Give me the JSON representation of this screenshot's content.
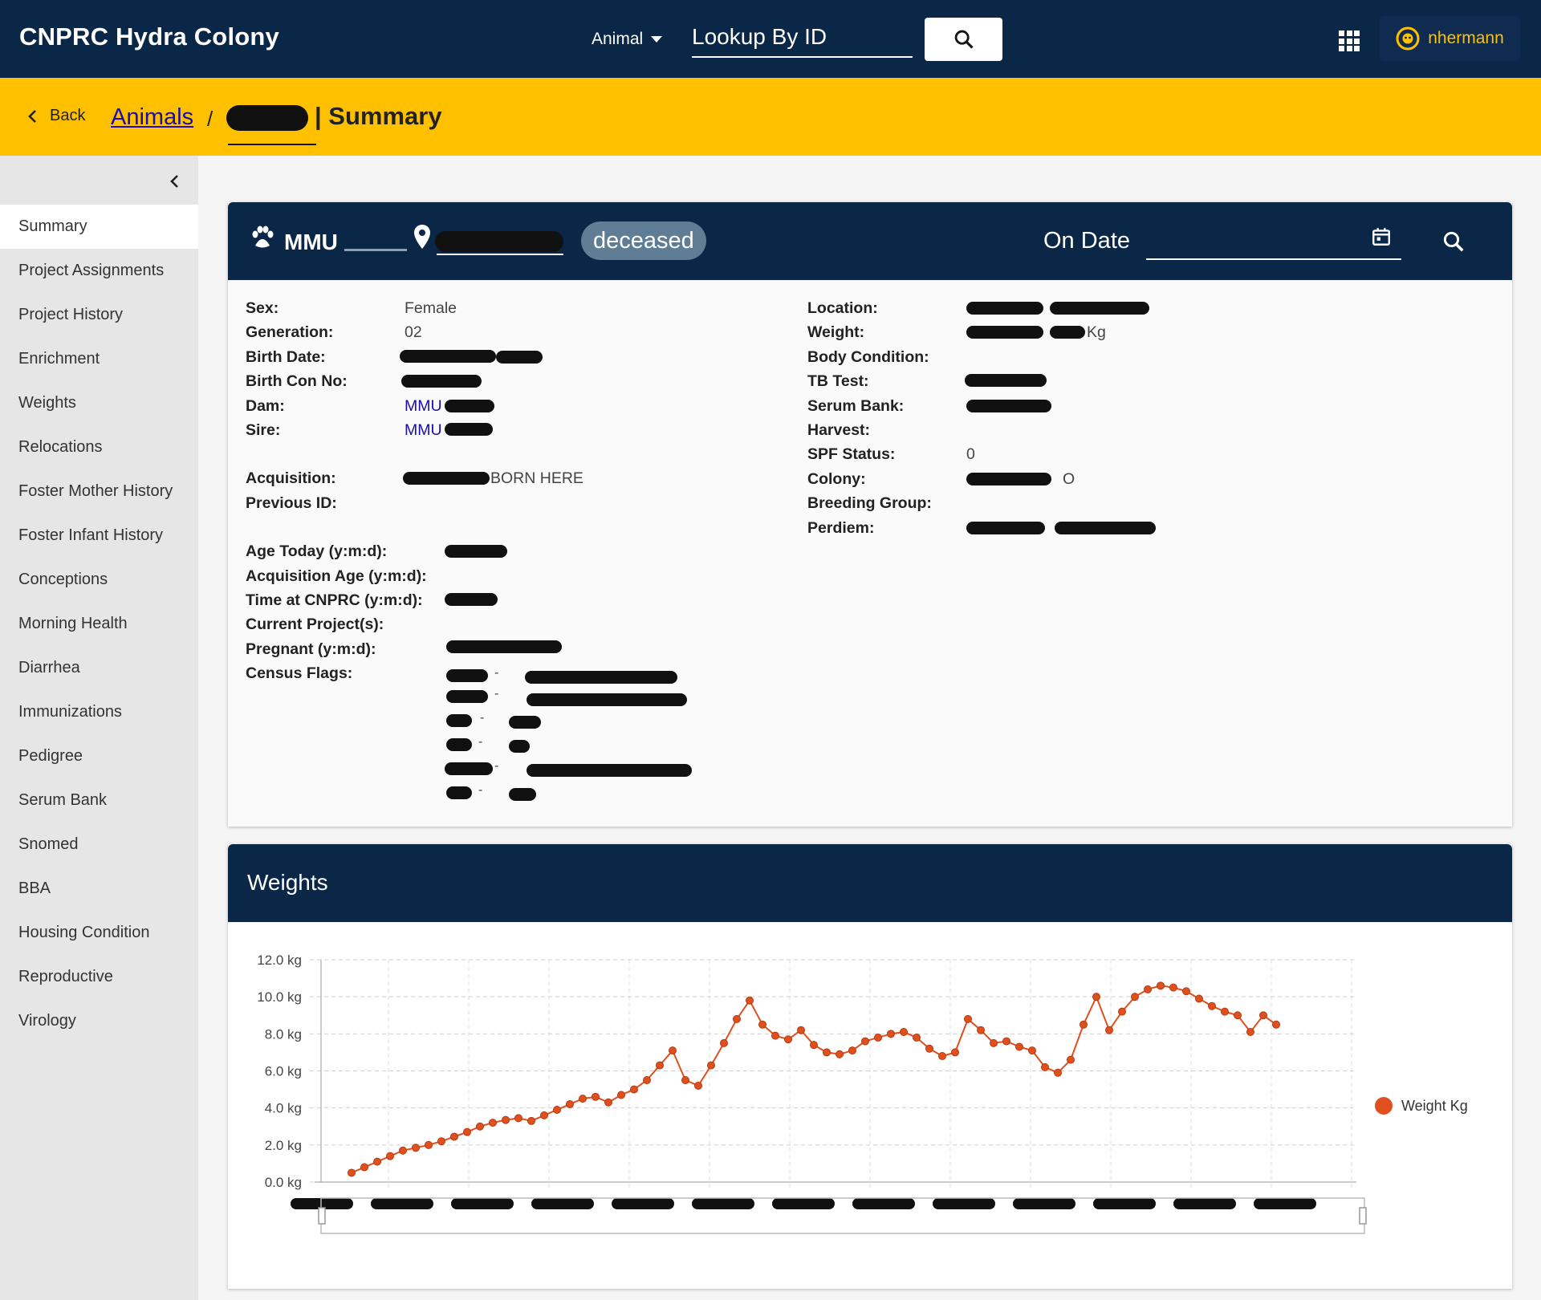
{
  "app": {
    "title": "CNPRC Hydra Colony"
  },
  "header": {
    "lookup_type": "Animal",
    "lookup_placeholder": "Lookup By ID",
    "search_icon": "search-icon",
    "apps_icon": "apps-grid-icon",
    "user": "nhermann",
    "user_icon": "user-face-icon"
  },
  "breadcrumb": {
    "back_label": "Back",
    "animals_label": "Animals",
    "separator": "/",
    "current_label": "| Summary"
  },
  "sidebar": {
    "items": [
      {
        "label": "Summary",
        "active": true
      },
      {
        "label": "Project Assignments"
      },
      {
        "label": "Project History"
      },
      {
        "label": "Enrichment"
      },
      {
        "label": "Weights"
      },
      {
        "label": "Relocations"
      },
      {
        "label": "Foster Mother History"
      },
      {
        "label": "Foster Infant History"
      },
      {
        "label": "Conceptions"
      },
      {
        "label": "Morning Health"
      },
      {
        "label": "Diarrhea"
      },
      {
        "label": "Immunizations"
      },
      {
        "label": "Pedigree"
      },
      {
        "label": "Serum Bank"
      },
      {
        "label": "Snomed"
      },
      {
        "label": "BBA"
      },
      {
        "label": "Housing Condition"
      },
      {
        "label": "Reproductive"
      },
      {
        "label": "Virology"
      }
    ]
  },
  "summary": {
    "animal_prefix": "MMU",
    "status": "deceased",
    "on_date_label": "On Date",
    "left": {
      "sex_label": "Sex:",
      "sex": "Female",
      "generation_label": "Generation:",
      "generation": "02",
      "birth_date_label": "Birth Date:",
      "birth_con_label": "Birth Con No:",
      "dam_label": "Dam:",
      "dam_prefix": "MMU",
      "sire_label": "Sire:",
      "sire_prefix": "MMU",
      "acquisition_label": "Acquisition:",
      "acquisition_suffix": "BORN HERE",
      "previous_id_label": "Previous ID:",
      "age_today_label": "Age Today (y:m:d):",
      "acq_age_label": "Acquisition Age (y:m:d):",
      "time_at_label": "Time at CNPRC (y:m:d):",
      "current_projects_label": "Current Project(s):",
      "pregnant_label": "Pregnant (y:m:d):",
      "census_flags_label": "Census Flags:"
    },
    "right": {
      "location_label": "Location:",
      "weight_label": "Weight:",
      "weight_unit": "Kg",
      "body_condition_label": "Body Condition:",
      "tb_test_label": "TB Test:",
      "serum_bank_label": "Serum Bank:",
      "harvest_label": "Harvest:",
      "spf_label": "SPF Status:",
      "spf": "0",
      "colony_label": "Colony:",
      "colony_suffix": "O",
      "breeding_group_label": "Breeding Group:",
      "perdiem_label": "Perdiem:"
    }
  },
  "weights_card": {
    "title": "Weights"
  },
  "chart_data": {
    "type": "line",
    "title": "",
    "xlabel": "",
    "ylabel": "",
    "ylim": [
      0,
      12
    ],
    "ytick_labels": [
      "0.0 kg",
      "2.0 kg",
      "4.0 kg",
      "6.0 kg",
      "8.0 kg",
      "10.0 kg",
      "12.0 kg"
    ],
    "grid": true,
    "legend_position": "right",
    "series": [
      {
        "name": "Weight Kg",
        "color": "#e0501f",
        "values": [
          0.5,
          0.8,
          1.1,
          1.4,
          1.7,
          1.85,
          2.0,
          2.2,
          2.45,
          2.7,
          3.0,
          3.2,
          3.35,
          3.45,
          3.3,
          3.6,
          3.9,
          4.2,
          4.5,
          4.6,
          4.3,
          4.7,
          5.0,
          5.5,
          6.3,
          7.1,
          5.5,
          5.2,
          6.3,
          7.5,
          8.8,
          9.8,
          8.5,
          7.9,
          7.7,
          8.2,
          7.4,
          7.0,
          6.9,
          7.1,
          7.6,
          7.8,
          8.0,
          8.1,
          7.8,
          7.2,
          6.8,
          7.0,
          8.8,
          8.2,
          7.5,
          7.6,
          7.3,
          7.1,
          6.2,
          5.9,
          6.6,
          8.5,
          10.0,
          8.2,
          9.2,
          10.0,
          10.4,
          10.6,
          10.5,
          10.3,
          9.9,
          9.5,
          9.2,
          9.0,
          8.1,
          9.0,
          8.5
        ]
      }
    ]
  }
}
